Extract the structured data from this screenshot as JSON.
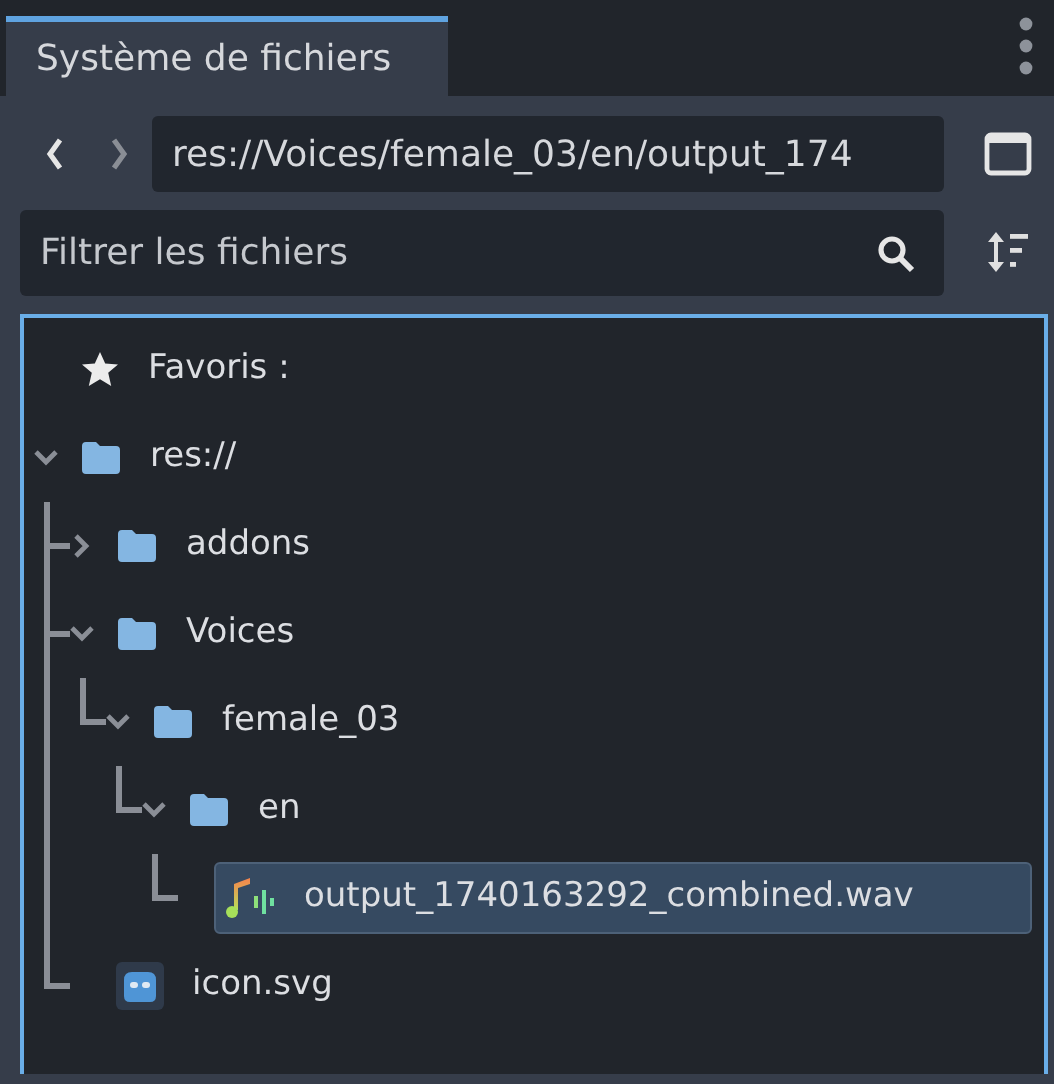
{
  "tabs": [
    {
      "label": "Système de fichiers",
      "selected": true
    }
  ],
  "path_field": {
    "value": "res://Voices/female_03/en/output_174"
  },
  "filter_field": {
    "placeholder": "Filtrer les fichiers"
  },
  "tree": [
    {
      "kind": "favorites",
      "label": "Favoris :",
      "selected": false
    },
    {
      "kind": "folder",
      "label": "res://",
      "expanded": true,
      "selected": false,
      "children": [
        {
          "kind": "folder",
          "label": "addons",
          "expanded": false,
          "selected": false
        },
        {
          "kind": "folder",
          "label": "Voices",
          "expanded": true,
          "selected": false,
          "children": [
            {
              "kind": "folder",
              "label": "female_03",
              "expanded": true,
              "selected": false,
              "children": [
                {
                  "kind": "folder",
                  "label": "en",
                  "expanded": true,
                  "selected": false,
                  "children": [
                    {
                      "kind": "audio",
                      "label": "output_1740163292_combined.wav",
                      "selected": true
                    }
                  ]
                }
              ]
            }
          ]
        },
        {
          "kind": "image",
          "label": "icon.svg",
          "selected": false
        }
      ]
    }
  ]
}
